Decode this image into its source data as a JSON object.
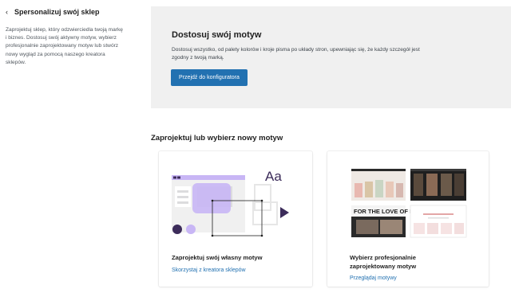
{
  "sidebar": {
    "title": "Spersonalizuj swój sklep",
    "description": "Zaprojektuj sklep, który odzwierciedla twoją markę i biznes. Dostosuj swój aktywny motyw, wybierz profesjonalnie zaprojektowany motyw lub stwórz nowy wygląd za pomocą naszego kreatora sklepów."
  },
  "banner": {
    "title": "Dostosuj swój motyw",
    "description": "Dostosuj wszystko, od palety kolorów i kroje pisma po układy stron, upewniając się, że każdy szczegół jest zgodny z twoją marką.",
    "button_label": "Przejdź do konfiguratora"
  },
  "section": {
    "title": "Zaprojektuj lub wybierz nowy motyw"
  },
  "cards": [
    {
      "title": "Zaprojektuj swój własny motyw",
      "link": "Skorzystaj z kreatora sklepów",
      "illustration_text": "Aa"
    },
    {
      "title_line1": "Wybierz profesjonalnie",
      "title_line2": "zaprojektowany motyw",
      "link": "Przeglądaj motywy",
      "poster_text": "FOR THE LOVE OF B"
    }
  ],
  "colors": {
    "accent": "#2271b1",
    "lavender": "#c8b6f5",
    "dark_purple": "#3c2c5a"
  }
}
